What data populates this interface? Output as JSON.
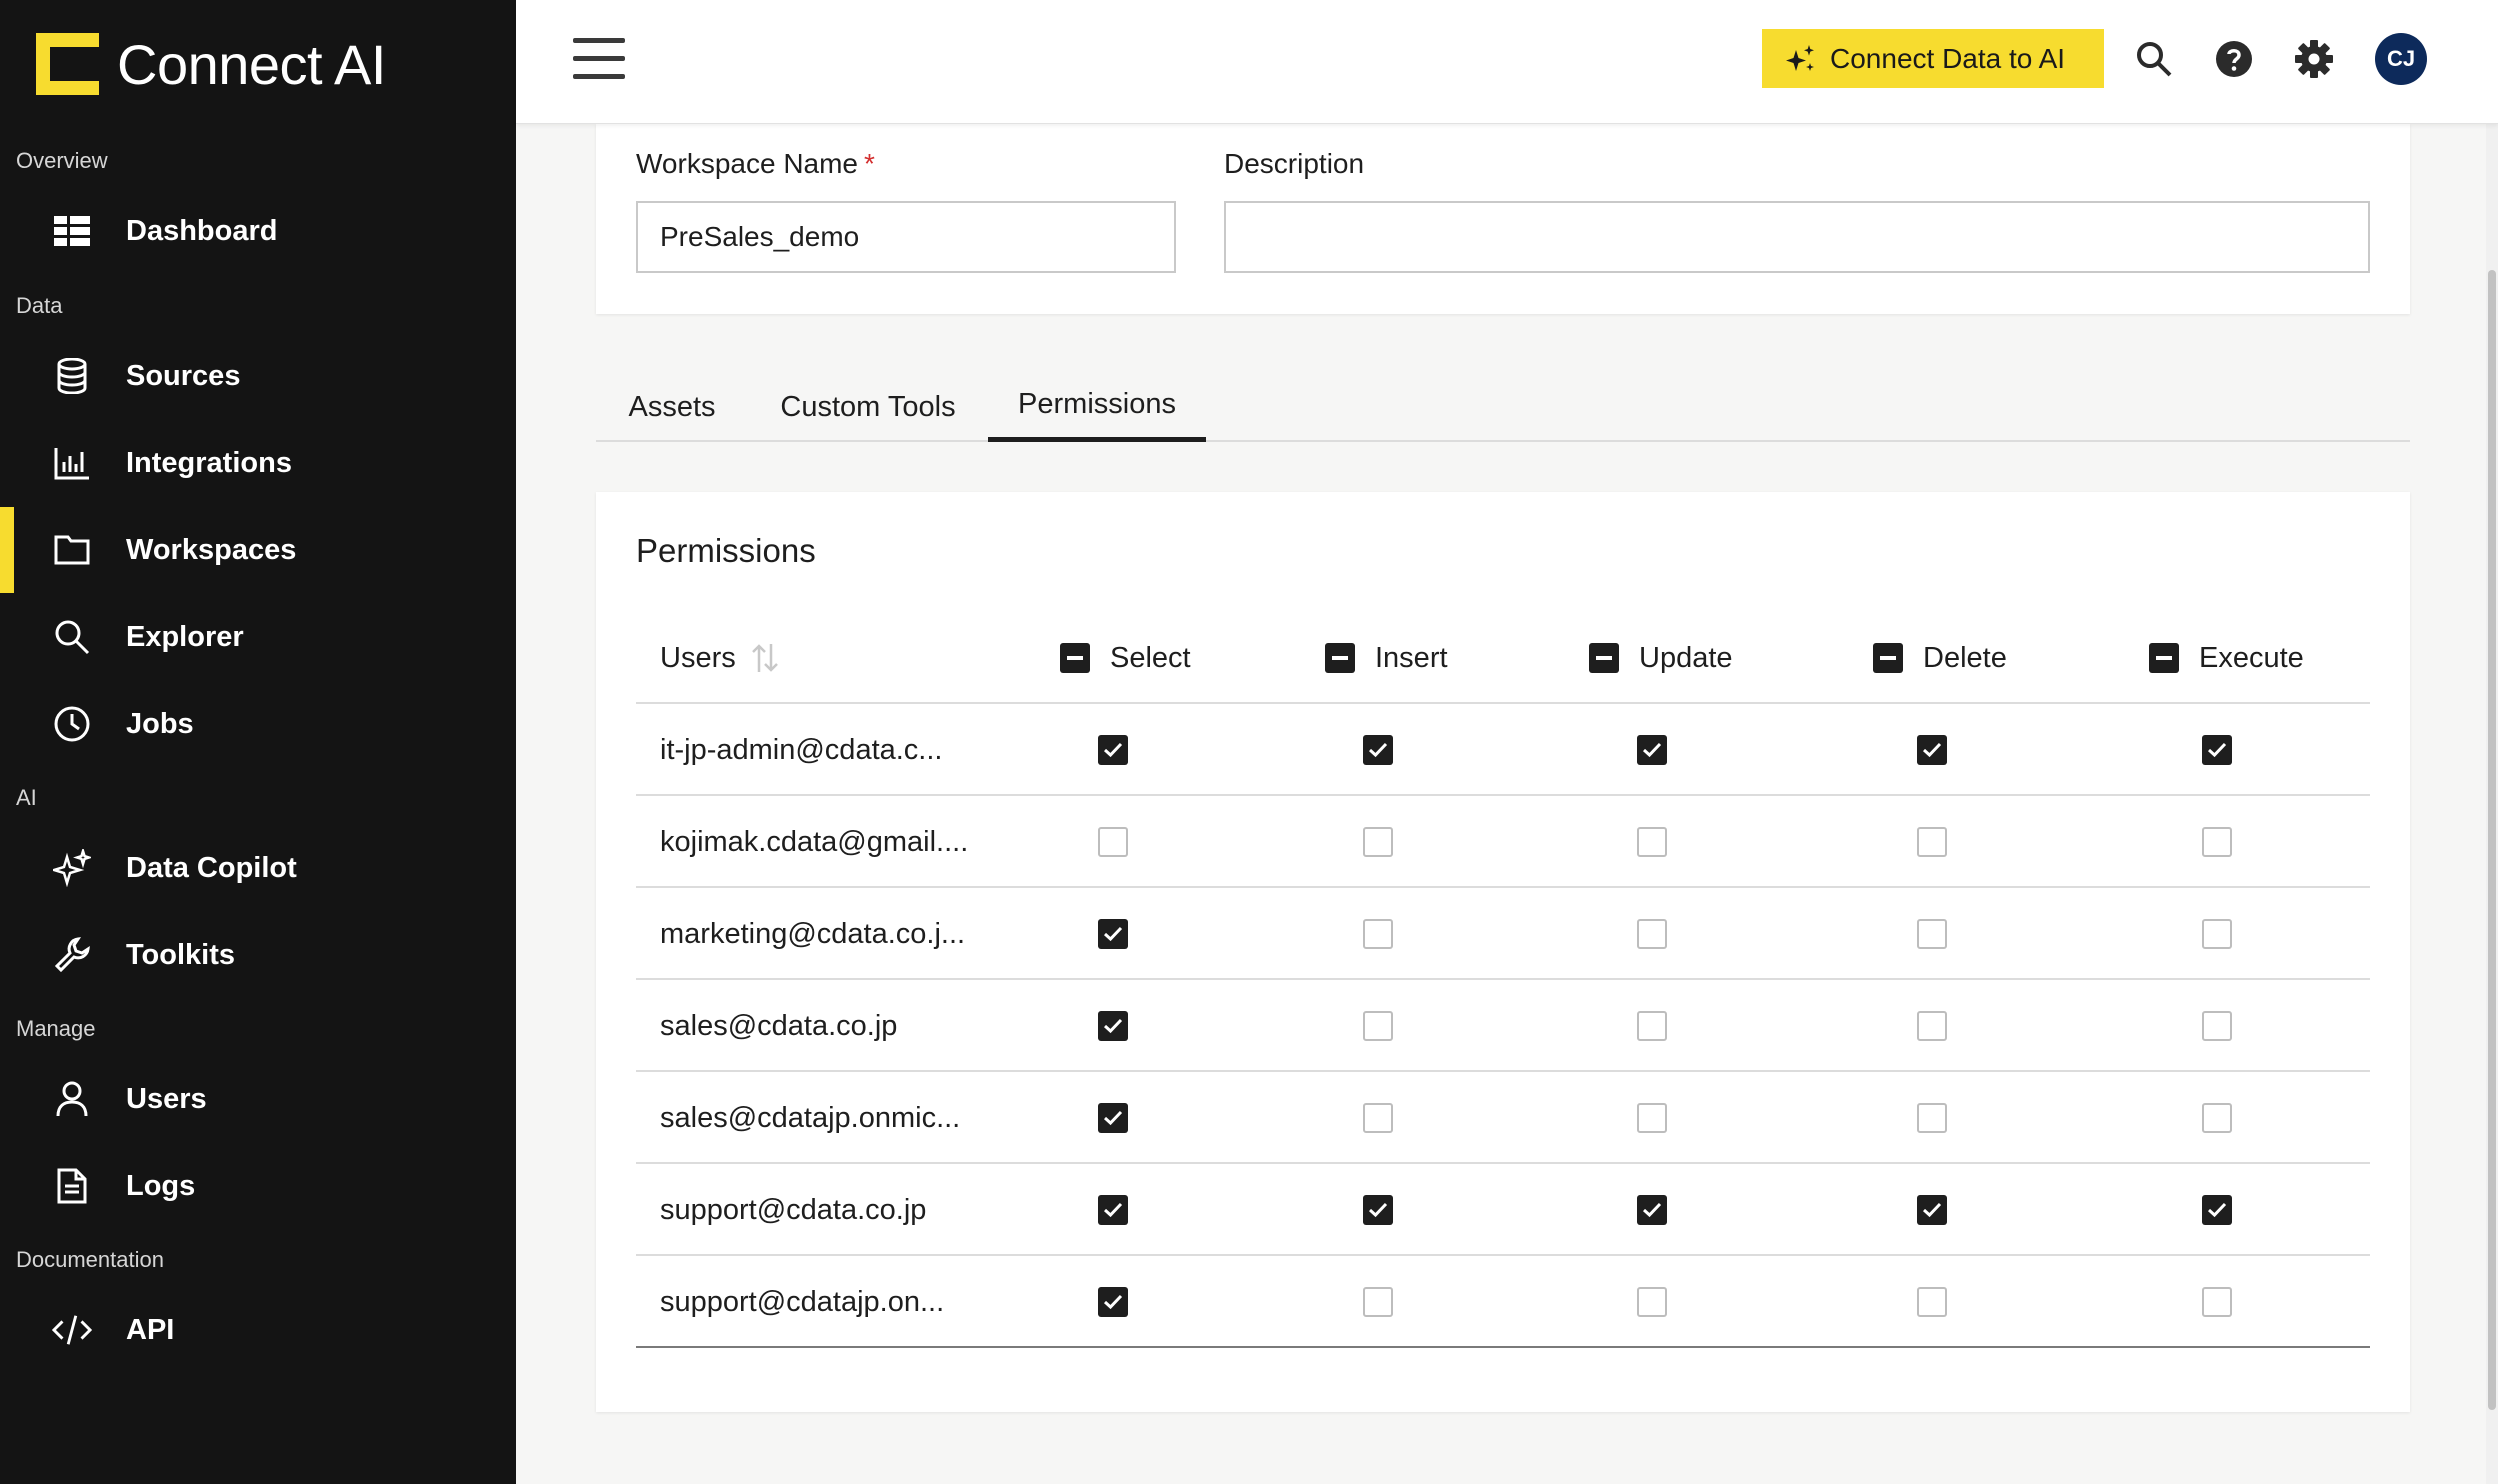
{
  "brand": {
    "name": "Connect AI",
    "accent": "#f7dc2f"
  },
  "sidebar": {
    "sections": [
      {
        "label": "Overview",
        "items": [
          {
            "label": "Dashboard",
            "icon": "dashboard-icon"
          }
        ]
      },
      {
        "label": "Data",
        "items": [
          {
            "label": "Sources",
            "icon": "database-icon"
          },
          {
            "label": "Integrations",
            "icon": "bar-chart-icon"
          },
          {
            "label": "Workspaces",
            "icon": "folder-icon",
            "active": true
          },
          {
            "label": "Explorer",
            "icon": "search-icon"
          },
          {
            "label": "Jobs",
            "icon": "clock-icon"
          }
        ]
      },
      {
        "label": "AI",
        "items": [
          {
            "label": "Data Copilot",
            "icon": "sparkle-icon"
          },
          {
            "label": "Toolkits",
            "icon": "wrench-icon"
          }
        ]
      },
      {
        "label": "Manage",
        "items": [
          {
            "label": "Users",
            "icon": "user-icon"
          },
          {
            "label": "Logs",
            "icon": "document-icon"
          }
        ]
      },
      {
        "label": "Documentation",
        "items": [
          {
            "label": "API",
            "icon": "code-icon"
          }
        ]
      }
    ]
  },
  "header": {
    "connect_button": "Connect Data to AI",
    "avatar_initials": "CJ"
  },
  "workspace": {
    "name_label": "Workspace Name",
    "required_mark": "*",
    "name_value": "PreSales_demo",
    "description_label": "Description",
    "description_value": ""
  },
  "tabs": [
    {
      "label": "Assets"
    },
    {
      "label": "Custom Tools"
    },
    {
      "label": "Permissions",
      "active": true
    }
  ],
  "permissions": {
    "title": "Permissions",
    "columns": {
      "users": "Users",
      "select": "Select",
      "insert": "Insert",
      "update": "Update",
      "delete": "Delete",
      "execute": "Execute"
    },
    "rows": [
      {
        "user": "it-jp-admin@cdata.c...",
        "select": true,
        "insert": true,
        "update": true,
        "delete": true,
        "execute": true
      },
      {
        "user": "kojimak.cdata@gmail....",
        "select": false,
        "insert": false,
        "update": false,
        "delete": false,
        "execute": false
      },
      {
        "user": "marketing@cdata.co.j...",
        "select": true,
        "insert": false,
        "update": false,
        "delete": false,
        "execute": false
      },
      {
        "user": "sales@cdata.co.jp",
        "select": true,
        "insert": false,
        "update": false,
        "delete": false,
        "execute": false
      },
      {
        "user": "sales@cdatajp.onmic...",
        "select": true,
        "insert": false,
        "update": false,
        "delete": false,
        "execute": false
      },
      {
        "user": "support@cdata.co.jp",
        "select": true,
        "insert": true,
        "update": true,
        "delete": true,
        "execute": true
      },
      {
        "user": "support@cdatajp.on...",
        "select": true,
        "insert": false,
        "update": false,
        "delete": false,
        "execute": false
      }
    ]
  }
}
